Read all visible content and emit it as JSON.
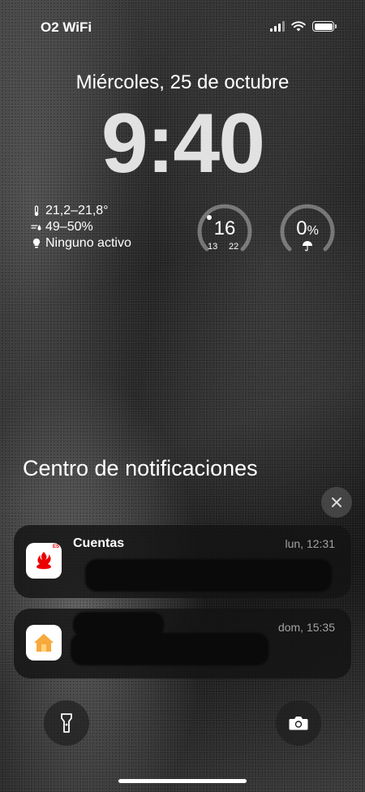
{
  "status_bar": {
    "carrier": "O2 WiFi",
    "icons": [
      "cellular-signal-icon",
      "wifi-icon",
      "battery-icon"
    ]
  },
  "lock_screen": {
    "date": "Miércoles, 25 de octubre",
    "time": "9:40"
  },
  "widgets": {
    "climate": {
      "temperature": "21,2–21,8°",
      "humidity": "49–50%",
      "lights": "Ninguno activo"
    },
    "temperature_gauge": {
      "value": "16",
      "min": "13",
      "max": "22"
    },
    "rain_gauge": {
      "value": "0",
      "unit": "%"
    }
  },
  "notification_center": {
    "title": "Centro de notificaciones",
    "notifications": [
      {
        "app": "Cuentas",
        "time": "lun, 12:31",
        "icon": "santander-icon",
        "badge": "ES"
      },
      {
        "app": "",
        "time": "dom, 15:35",
        "icon": "home-app-icon"
      }
    ]
  },
  "bottom": {
    "left": "flashlight-icon",
    "right": "camera-icon"
  },
  "colors": {
    "santander_red": "#EC0000",
    "home_orange": "#F7A93B"
  }
}
